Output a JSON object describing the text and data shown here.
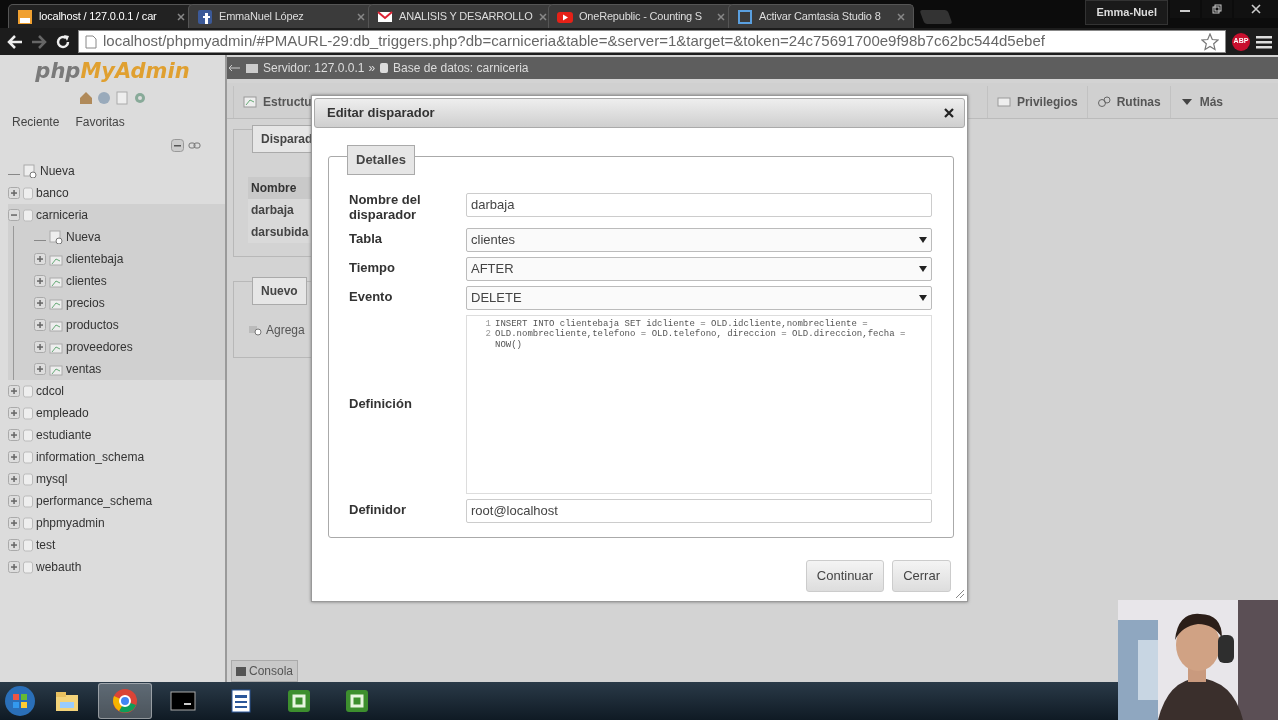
{
  "browser": {
    "tabs": [
      {
        "title": "localhost / 127.0.0.1 / car",
        "kind": "pma",
        "selected": true
      },
      {
        "title": "EmmaNuel López",
        "kind": "social",
        "selected": false
      },
      {
        "title": "ANALISIS Y DESARROLLO",
        "kind": "mail",
        "selected": false
      },
      {
        "title": "OneRepublic - Counting S",
        "kind": "video",
        "selected": false
      },
      {
        "title": "Activar Camtasia Studio 8",
        "kind": "camtasia",
        "selected": false
      }
    ],
    "user": "Emma-Nuel",
    "url": "localhost/phpmyadmin/#PMAURL-29:db_triggers.php?db=carniceria&table=&server=1&target=&token=24c75691700e9f98b7c62bc544d5ebef",
    "adblock": "ABP"
  },
  "sidebar": {
    "logo_a": "php",
    "logo_b": "MyAdmin",
    "links": [
      "Reciente",
      "Favoritas"
    ],
    "tree": [
      {
        "name": "Nueva",
        "kind": "new"
      },
      {
        "name": "banco",
        "kind": "db",
        "expanded": false,
        "selected": false
      },
      {
        "name": "carniceria",
        "kind": "db",
        "expanded": true,
        "selected": true,
        "children": [
          {
            "name": "Nueva",
            "kind": "new"
          },
          {
            "name": "clientebaja",
            "kind": "table",
            "expanded": false
          },
          {
            "name": "clientes",
            "kind": "table",
            "expanded": false
          },
          {
            "name": "precios",
            "kind": "table",
            "expanded": false
          },
          {
            "name": "productos",
            "kind": "table",
            "expanded": false
          },
          {
            "name": "proveedores",
            "kind": "table",
            "expanded": false
          },
          {
            "name": "ventas",
            "kind": "table",
            "expanded": false
          }
        ]
      },
      {
        "name": "cdcol",
        "kind": "db",
        "expanded": false,
        "selected": false
      },
      {
        "name": "empleado",
        "kind": "db",
        "expanded": false,
        "selected": false
      },
      {
        "name": "estudiante",
        "kind": "db",
        "expanded": false,
        "selected": false
      },
      {
        "name": "information_schema",
        "kind": "db",
        "expanded": false,
        "selected": false
      },
      {
        "name": "mysql",
        "kind": "db",
        "expanded": false,
        "selected": false
      },
      {
        "name": "performance_schema",
        "kind": "db",
        "expanded": false,
        "selected": false
      },
      {
        "name": "phpmyadmin",
        "kind": "db",
        "expanded": false,
        "selected": false
      },
      {
        "name": "test",
        "kind": "db",
        "expanded": false,
        "selected": false
      },
      {
        "name": "webauth",
        "kind": "db",
        "expanded": false,
        "selected": false
      }
    ]
  },
  "breadcrumb": {
    "server": "Servidor: 127.0.0.1",
    "separator": "»",
    "database": "Base de datos: carniceria"
  },
  "tabs": [
    {
      "label": "Estructu",
      "kind": "structure",
      "selected": false
    },
    {
      "label": "Privilegios",
      "kind": "privileges",
      "selected": false
    },
    {
      "label": "Rutinas",
      "kind": "routines",
      "selected": false
    },
    {
      "label": "Más",
      "kind": "more",
      "selected": false
    }
  ],
  "triggers_panel": {
    "legend": "Disparad",
    "header": "Nombre",
    "rows": [
      "darbaja",
      "darsubida"
    ]
  },
  "new_panel": {
    "legend": "Nuevo",
    "action": "Agrega"
  },
  "dialog": {
    "title": "Editar disparador",
    "legend": "Detalles",
    "fields": [
      {
        "label": "Nombre del disparador",
        "kind": "text",
        "value": "darbaja"
      },
      {
        "label": "Tabla",
        "kind": "select",
        "value": "clientes"
      },
      {
        "label": "Tiempo",
        "kind": "select",
        "value": "AFTER"
      },
      {
        "label": "Evento",
        "kind": "select",
        "value": "DELETE"
      },
      {
        "label": "Definición",
        "kind": "code",
        "lines": [
          {
            "number": "1",
            "text": "INSERT INTO clientebaja SET idcliente = OLD.idcliente,nombrecliente ="
          },
          {
            "number": "2",
            "text": "OLD.nombrecliente,telefono = OLD.telefono, direccion = OLD.direccion,fecha = NOW()"
          }
        ]
      },
      {
        "label": "Definidor",
        "kind": "text",
        "value": "root@localhost"
      }
    ],
    "buttons": [
      "Continuar",
      "Cerrar"
    ]
  },
  "console": "Consola",
  "taskbar": {
    "apps": [
      {
        "kind": "explorer",
        "selected": false
      },
      {
        "kind": "chrome",
        "selected": true
      },
      {
        "kind": "cmd",
        "selected": false
      },
      {
        "kind": "word",
        "selected": false
      },
      {
        "kind": "camtasia",
        "selected": false
      },
      {
        "kind": "camtasia",
        "selected": false
      }
    ]
  }
}
